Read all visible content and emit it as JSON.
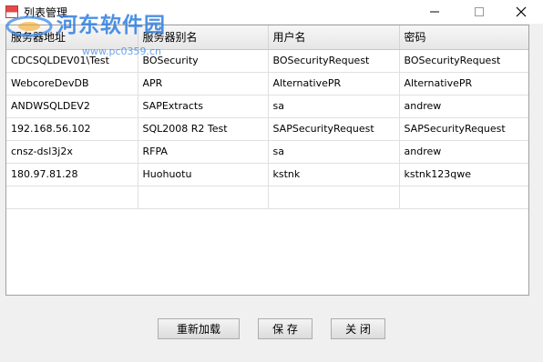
{
  "window": {
    "title": "列表管理",
    "icon": "app-icon",
    "controls": [
      "minimize-icon",
      "maximize-icon",
      "close-icon"
    ]
  },
  "watermark": {
    "text": "河东软件园",
    "url": "www.pc0359.cn"
  },
  "table": {
    "columns": [
      "服务器地址",
      "服务器别名",
      "用户名",
      "密码"
    ],
    "rows": [
      [
        "CDCSQLDEV01\\Test",
        "BOSecurity",
        "BOSecurityRequest",
        "BOSecurityRequest"
      ],
      [
        "WebcoreDevDB",
        "APR",
        "AlternativePR",
        "AlternativePR"
      ],
      [
        "ANDWSQLDEV2",
        "SAPExtracts",
        "sa",
        "andrew"
      ],
      [
        "192.168.56.102",
        "SQL2008 R2 Test",
        "SAPSecurityRequest",
        "SAPSecurityRequest"
      ],
      [
        "cnsz-dsl3j2x",
        "RFPA",
        "sa",
        "andrew"
      ],
      [
        "180.97.81.28",
        "Huohuotu",
        "kstnk",
        "kstnk123qwe"
      ],
      [
        "",
        "",
        "",
        ""
      ]
    ]
  },
  "buttons": {
    "reload": "重新加载",
    "save": "保 存",
    "close": "关 闭"
  },
  "colors": {
    "window_bg": "#f0f0f0",
    "watermark": "#2e7ee0"
  }
}
